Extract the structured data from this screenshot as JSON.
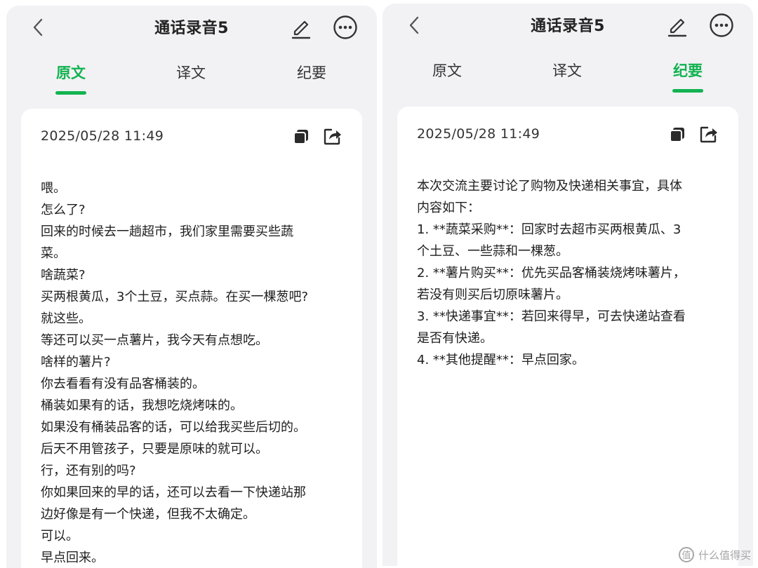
{
  "left": {
    "title": "通话录音5",
    "tabs": [
      {
        "label": "原文",
        "active": true
      },
      {
        "label": "译文",
        "active": false
      },
      {
        "label": "纪要",
        "active": false
      }
    ],
    "date": "2025/05/28 11:49",
    "lines": [
      "喂。",
      "怎么了?",
      "回来的时候去一趟超市，我们家里需要买些蔬",
      "菜。",
      "啥蔬菜?",
      "买两根黄瓜，3个土豆，买点蒜。在买一棵葱吧?",
      "就这些。",
      "等还可以买一点薯片，我今天有点想吃。",
      "啥样的薯片?",
      "你去看看有没有品客桶装的。",
      "桶装如果有的话，我想吃烧烤味的。",
      "如果没有桶装品客的话，可以给我买些后切的。",
      "后天不用管孩子，只要是原味的就可以。",
      "行，还有别的吗?",
      "你如果回来的早的话，还可以去看一下快递站那",
      "边好像是有一个快递，但我不太确定。",
      "可以。",
      "早点回来。"
    ]
  },
  "right": {
    "title": "通话录音5",
    "tabs": [
      {
        "label": "原文",
        "active": false
      },
      {
        "label": "译文",
        "active": false
      },
      {
        "label": "纪要",
        "active": true
      }
    ],
    "date": "2025/05/28 11:49",
    "lines": [
      "本次交流主要讨论了购物及快递相关事宜，具体",
      "内容如下：",
      "1. **蔬菜采购**：回家时去超市买两根黄瓜、3",
      "个土豆、一些蒜和一棵葱。",
      "2. **薯片购买**：优先买品客桶装烧烤味薯片，",
      "若没有则买后切原味薯片。",
      "3. **快递事宜**：若回来得早，可去快递站查看",
      "是否有快递。",
      "4. **其他提醒**：早点回家。"
    ]
  },
  "watermark": "什么值得买",
  "watermark_logo": "值",
  "accent_color": "#12b350",
  "icons": [
    "back-icon",
    "edit-icon",
    "more-icon",
    "copy-icon",
    "share-icon"
  ]
}
